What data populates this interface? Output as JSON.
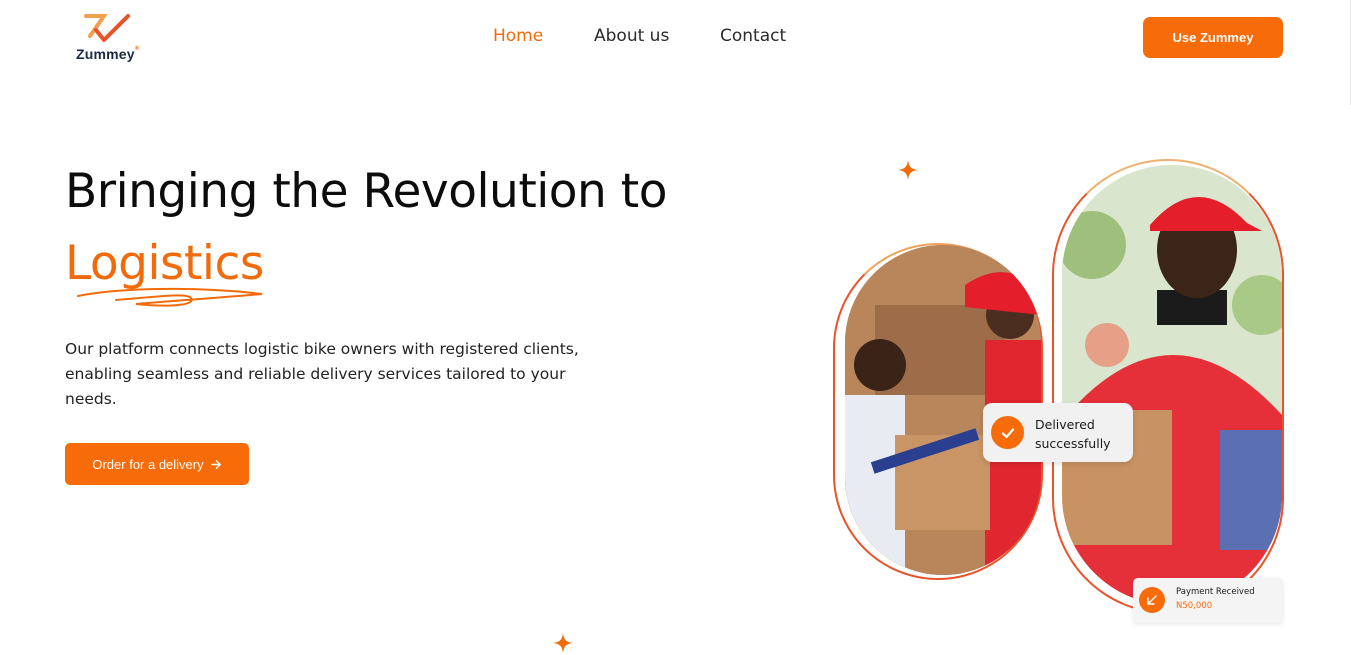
{
  "brand": {
    "name": "Zummey",
    "tm": "®",
    "accent": "#f76b08",
    "dark": "#1d2a44"
  },
  "nav": {
    "items": [
      {
        "label": "Home",
        "active": true
      },
      {
        "label": "About us",
        "active": false
      },
      {
        "label": "Contact",
        "active": false
      }
    ],
    "cta_label": "Use Zummey"
  },
  "hero": {
    "title": "Bringing the Revolution to",
    "highlight": "Logistics",
    "description": "Our platform connects logistic bike owners with registered clients, enabling seamless and reliable delivery services tailored to your needs.",
    "cta_label": "Order for a delivery",
    "cta_icon": "arrow-right-icon"
  },
  "badges": {
    "delivered": {
      "line1": "Delivered",
      "line2": "successfully",
      "icon": "check-icon"
    },
    "payment": {
      "title": "Payment Received",
      "amount": "N50,000",
      "icon": "arrow-down-left-icon"
    }
  }
}
